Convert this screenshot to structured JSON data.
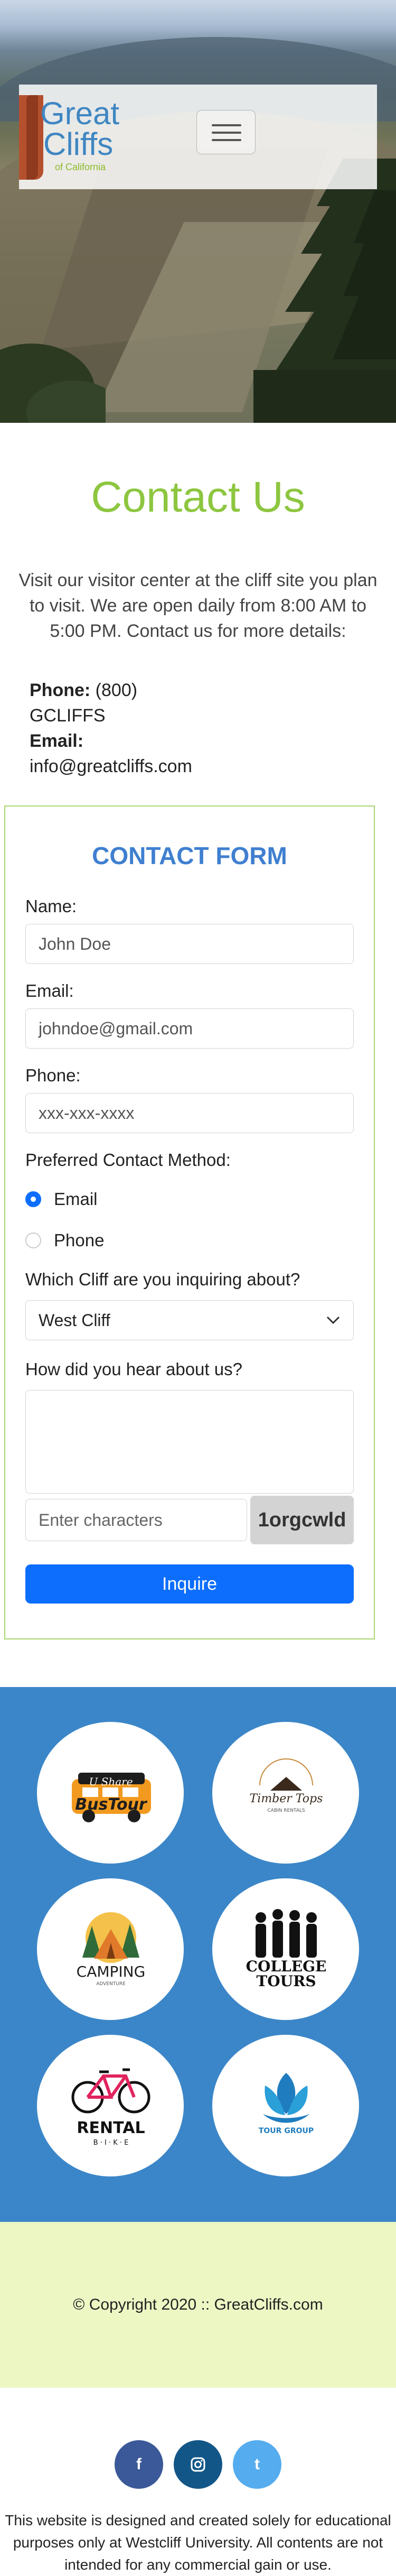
{
  "header": {
    "logo_line1": "Great",
    "logo_line2": "Cliffs",
    "logo_line3": "of California"
  },
  "contact": {
    "title": "Contact Us",
    "intro": "Visit our visitor center at the cliff site you plan to visit. We are open daily from 8:00 AM to 5:00 PM. Contact us for more details:",
    "phone_label": "Phone:",
    "phone_value_1": "(800)",
    "phone_value_2": "GCLIFFS",
    "email_label": "Email:",
    "email_value": "info@greatcliffs.com"
  },
  "form": {
    "title": "CONTACT FORM",
    "name_label": "Name:",
    "name_placeholder": "John Doe",
    "email_label": "Email:",
    "email_placeholder": "johndoe@gmail.com",
    "phone_label": "Phone:",
    "phone_placeholder": "xxx-xxx-xxxx",
    "method_label": "Preferred Contact Method:",
    "method_options": [
      "Email",
      "Phone"
    ],
    "method_selected": "Email",
    "cliff_label": "Which Cliff are you inquiring about?",
    "cliff_selected": "West Cliff",
    "hear_label": "How did you hear about us?",
    "captcha_placeholder": "Enter characters",
    "captcha_code": "1orgcwld",
    "submit_label": "Inquire"
  },
  "partners": {
    "badge1_line1": "U Share",
    "badge1_line2": "BusTour",
    "badge2_line1": "Timber Tops",
    "badge2_line2": "CABIN RENTALS",
    "badge3_line1": "CAMPING",
    "badge3_line2": "ADVENTURE",
    "badge4_line1": "COLLEGE",
    "badge4_line2": "TOURS",
    "badge5_line1": "RENTAL",
    "badge5_line2": "B · I · K · E",
    "badge6_line1": "TOUR GROUP"
  },
  "footer": {
    "copyright": "© Copyright 2020 :: GreatCliffs.com",
    "facebook": "f",
    "twitter": "t",
    "disclaimer": "This website is designed and created solely for educational purposes only at Westcliff University. All contents are not intended for any commercial gain or use."
  },
  "colors": {
    "accent_green": "#8dc63f",
    "form_title_blue": "#3f7fd0",
    "primary_button": "#0d6efd",
    "partners_bg": "#3b86c8",
    "footer_bg": "#ecf7c4",
    "facebook": "#3b5998",
    "instagram": "#125688",
    "twitter": "#55acee"
  }
}
